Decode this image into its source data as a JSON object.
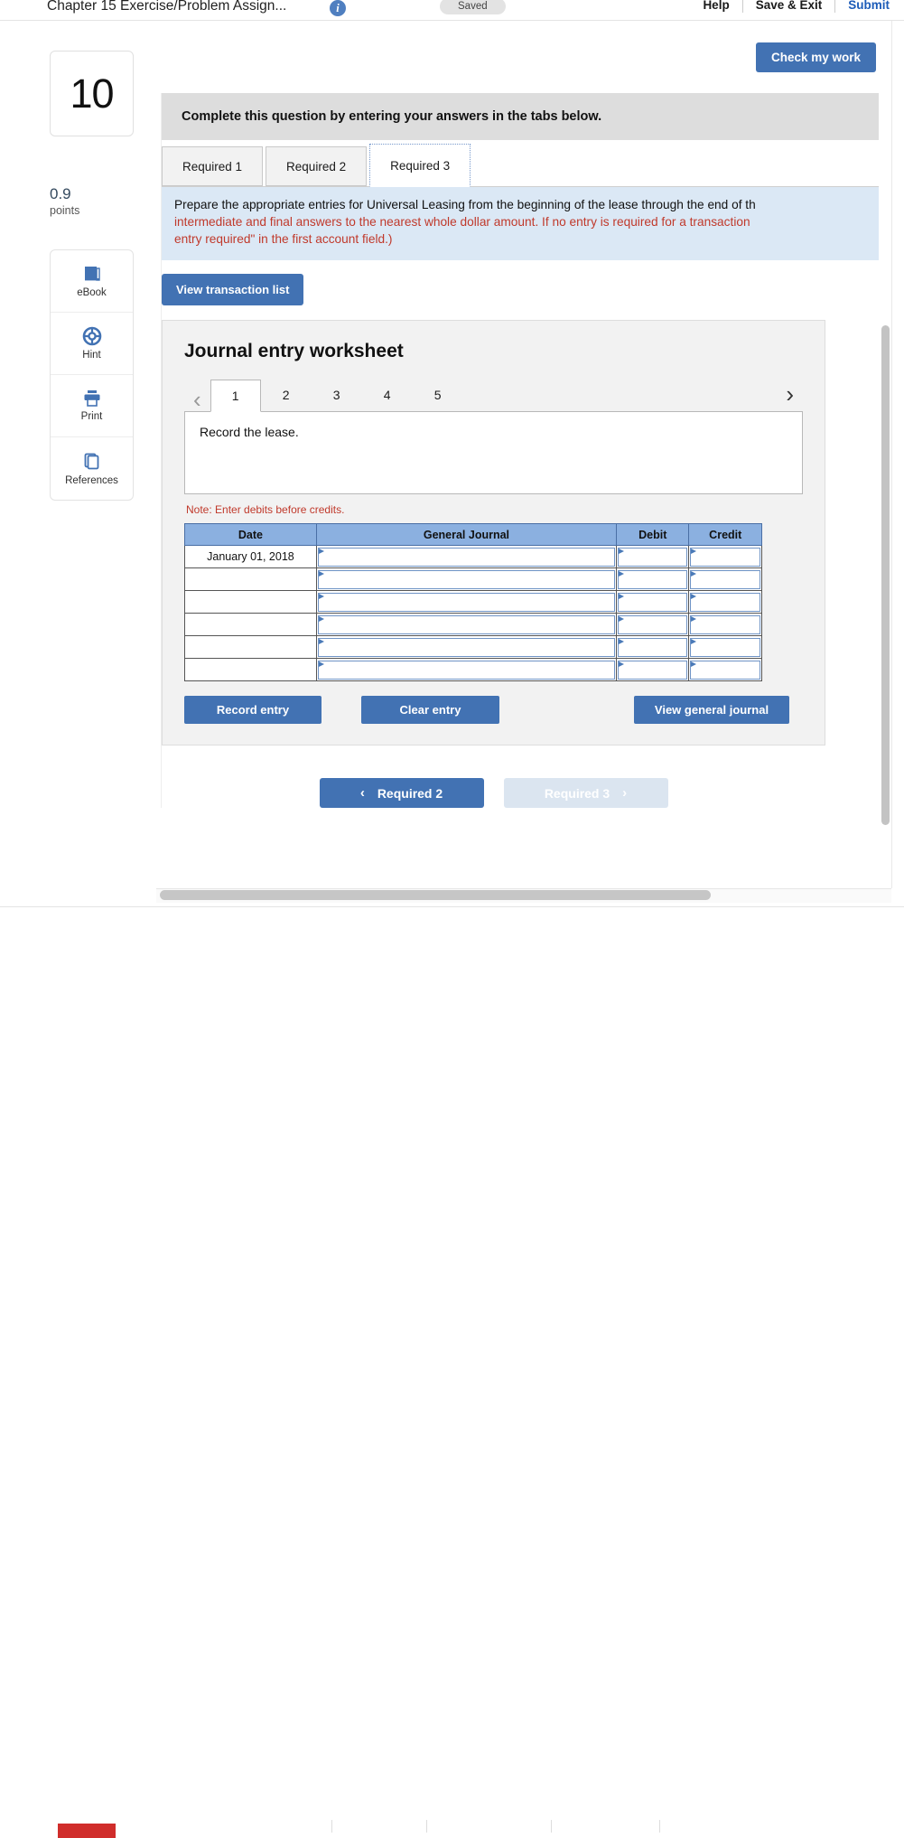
{
  "appbar": {
    "title": "Chapter 15 Exercise/Problem Assign...",
    "info_icon": "info-icon",
    "saved_label": "Saved",
    "help_label": "Help",
    "save_exit_label": "Save & Exit",
    "submit_label": "Submit",
    "submit_color": "#1c5bb8"
  },
  "rail": {
    "question_number": "10",
    "points_value": "0.9",
    "points_label": "points",
    "tools": [
      {
        "label": "eBook",
        "icon": "ebook-icon"
      },
      {
        "label": "Hint",
        "icon": "life-ring-icon"
      },
      {
        "label": "Print",
        "icon": "printer-icon"
      },
      {
        "label": "References",
        "icon": "copy-pages-icon"
      }
    ]
  },
  "main": {
    "check_my_work_label": "Check my work",
    "banner": "Complete this question by entering your answers in the tabs below.",
    "tabs": [
      {
        "label": "Required 1",
        "active": false
      },
      {
        "label": "Required 2",
        "active": false
      },
      {
        "label": "Required 3",
        "active": true
      }
    ],
    "instructions": {
      "line1_black": "Prepare the appropriate entries for Universal Leasing from the beginning of the lease through the end of th",
      "line2_red": "intermediate and final answers to the nearest whole dollar amount. If no entry is required for a transaction",
      "line3_red": "entry required\" in the first account field.)"
    },
    "view_transaction_list_label": "View transaction list"
  },
  "worksheet": {
    "title": "Journal entry worksheet",
    "prev_arrow": "‹",
    "next_arrow": "›",
    "entry_tabs": [
      "1",
      "2",
      "3",
      "4",
      "5"
    ],
    "active_entry_tab": "1",
    "description": "Record the lease.",
    "note": "Note: Enter debits before credits.",
    "table": {
      "headers": [
        "Date",
        "General Journal",
        "Debit",
        "Credit"
      ],
      "rows": [
        {
          "date": "January 01, 2018",
          "general_journal": "",
          "debit": "",
          "credit": ""
        },
        {
          "date": "",
          "general_journal": "",
          "debit": "",
          "credit": ""
        },
        {
          "date": "",
          "general_journal": "",
          "debit": "",
          "credit": ""
        },
        {
          "date": "",
          "general_journal": "",
          "debit": "",
          "credit": ""
        },
        {
          "date": "",
          "general_journal": "",
          "debit": "",
          "credit": ""
        },
        {
          "date": "",
          "general_journal": "",
          "debit": "",
          "credit": ""
        }
      ]
    },
    "buttons": {
      "record_entry": "Record entry",
      "clear_entry": "Clear entry",
      "view_general_journal": "View general journal"
    }
  },
  "navigation": {
    "prev_label": "Required 2",
    "prev_chevron": "‹",
    "next_label": "Required 3",
    "next_chevron": "›"
  },
  "colors": {
    "primary_blue": "#4272b3",
    "table_header_blue": "#8bb0e0",
    "instruction_bg": "#dbe8f5",
    "banner_bg": "#dddddd",
    "red_text": "#c0392b"
  }
}
